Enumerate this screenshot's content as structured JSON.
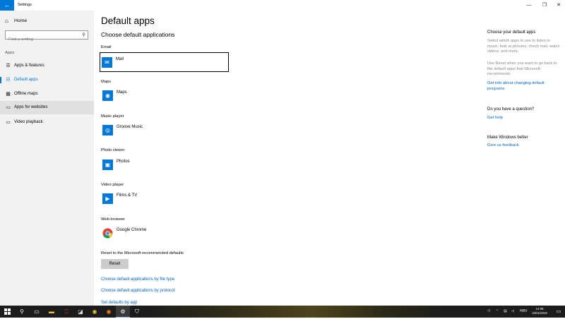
{
  "window": {
    "title": "Settings",
    "back_icon": "arrow-left-icon",
    "min_glyph": "—",
    "max_glyph": "❐",
    "close_glyph": "✕"
  },
  "nav": {
    "home_label": "Home",
    "search_placeholder": "Find a setting",
    "section_label": "Apps",
    "items": [
      {
        "label": "Apps & features",
        "icon": "list-icon",
        "selected": false
      },
      {
        "label": "Default apps",
        "icon": "default-apps-icon",
        "selected": true
      },
      {
        "label": "Offline maps",
        "icon": "map-icon",
        "selected": false
      },
      {
        "label": "Apps for websites",
        "icon": "web-icon",
        "selected": false
      },
      {
        "label": "Video playback",
        "icon": "video-icon",
        "selected": false
      }
    ]
  },
  "main": {
    "title": "Default apps",
    "subtitle": "Choose default applications",
    "categories": [
      {
        "label": "Email",
        "app": "Mail",
        "icon": "mail-icon"
      },
      {
        "label": "Maps",
        "app": "Maps",
        "icon": "maps-icon"
      },
      {
        "label": "Music player",
        "app": "Groove Music",
        "icon": "music-icon"
      },
      {
        "label": "Photo viewer",
        "app": "Photos",
        "icon": "photos-icon"
      },
      {
        "label": "Video player",
        "app": "Films & TV",
        "icon": "films-icon"
      },
      {
        "label": "Web browser",
        "app": "Google Chrome",
        "icon": "chrome-icon"
      }
    ],
    "reset_label": "Reset to the Microsoft recommended defaults",
    "reset_button": "Reset",
    "links": [
      "Choose default applications by file type",
      "Choose default applications by protocol",
      "Set defaults by app"
    ]
  },
  "right_panel": {
    "choose_title": "Choose your default apps",
    "choose_text": "Select which apps to use to listen to music, look at pictures, check mail, watch videos, and more.",
    "reset_text": "Use Reset when you want to go back to the default apps that Microsoft recommends.",
    "info_link": "Get info about changing default programs",
    "question_title": "Do you have a question?",
    "help_link": "Get help",
    "better_title": "Make Windows better",
    "feedback_link": "Give us feedback"
  },
  "taskbar": {
    "language": "HRV",
    "time": "14:09",
    "date": "23/01/2018"
  },
  "colors": {
    "accent": "#0078d7",
    "link": "#0062c4",
    "nav_bg": "#f2f2f2",
    "taskbar": "#1c1c1c"
  }
}
